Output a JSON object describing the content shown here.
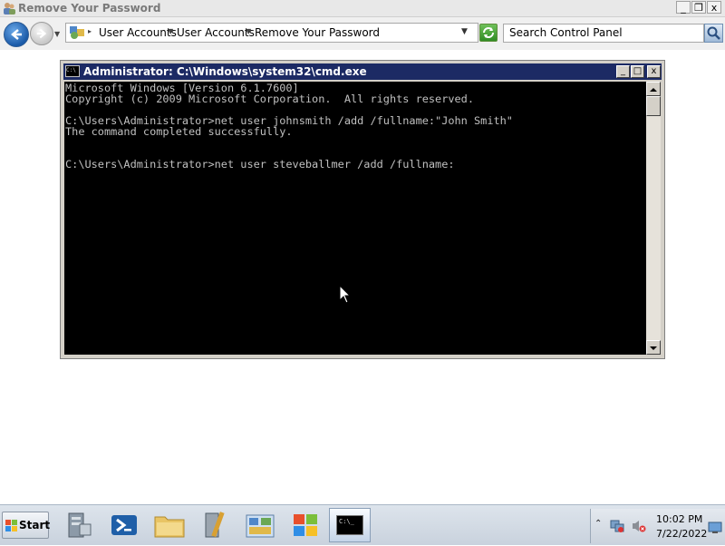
{
  "window": {
    "title": "Remove Your Password",
    "controls": {
      "minimize": "_",
      "maximize": "❐",
      "close": "x"
    }
  },
  "address_bar": {
    "breadcrumbs": [
      "User Accounts",
      "User Accounts",
      "Remove Your Password"
    ],
    "search_placeholder": "Search Control Panel"
  },
  "cmd": {
    "title": "Administrator: C:\\Windows\\system32\\cmd.exe",
    "icon_text": "C:\\",
    "lines": [
      "Microsoft Windows [Version 6.1.7600]",
      "Copyright (c) 2009 Microsoft Corporation.  All rights reserved.",
      "",
      "C:\\Users\\Administrator>net user johnsmith /add /fullname:\"John Smith\"",
      "The command completed successfully.",
      "",
      "",
      "C:\\Users\\Administrator>net user steveballmer /add /fullname:"
    ]
  },
  "taskbar": {
    "start_label": "Start",
    "items": [
      {
        "name": "server-manager-icon"
      },
      {
        "name": "powershell-icon"
      },
      {
        "name": "explorer-icon"
      },
      {
        "name": "admin-tools-icon"
      },
      {
        "name": "control-panel-icon"
      },
      {
        "name": "windows-media-icon"
      },
      {
        "name": "cmd-icon",
        "label": "C:\\_",
        "active": true
      }
    ],
    "clock": {
      "time": "10:02 PM",
      "date": "7/22/2022"
    }
  },
  "colors": {
    "console_bg": "#000000",
    "console_text": "#c0c0c0",
    "cmd_titlebar": "#1c2a64"
  }
}
